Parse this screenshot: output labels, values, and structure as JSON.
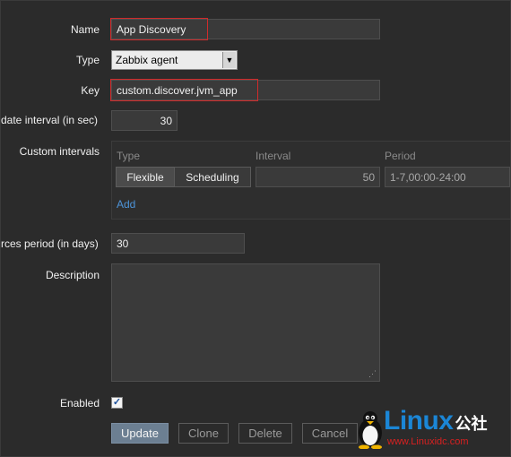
{
  "form": {
    "name": {
      "label": "Name",
      "value": "App Discovery"
    },
    "type": {
      "label": "Type",
      "value": "Zabbix agent"
    },
    "key": {
      "label": "Key",
      "value": "custom.discover.jvm_app"
    },
    "update_interval": {
      "label": "date interval (in sec)",
      "value": "30"
    },
    "custom_intervals": {
      "label": "Custom intervals",
      "headers": {
        "type": "Type",
        "interval": "Interval",
        "period": "Period"
      },
      "toggle": {
        "flexible": "Flexible",
        "scheduling": "Scheduling"
      },
      "interval_value": "50",
      "period_value": "1-7,00:00-24:00",
      "add_label": "Add"
    },
    "keep_lost": {
      "label": "rces period (in days)",
      "value": "30"
    },
    "description": {
      "label": "Description",
      "value": ""
    },
    "enabled": {
      "label": "Enabled",
      "checked": true,
      "check_glyph": "✓"
    }
  },
  "buttons": {
    "update": "Update",
    "clone": "Clone",
    "delete": "Delete",
    "cancel": "Cancel"
  },
  "watermark": {
    "brand": "Linux",
    "suffix": "公社",
    "url": "www.Linuxidc.com"
  },
  "colors": {
    "background": "#2b2b2b",
    "highlight_border": "#d02b2b",
    "link": "#4d94d8",
    "primary_button": "#6c7f92"
  }
}
